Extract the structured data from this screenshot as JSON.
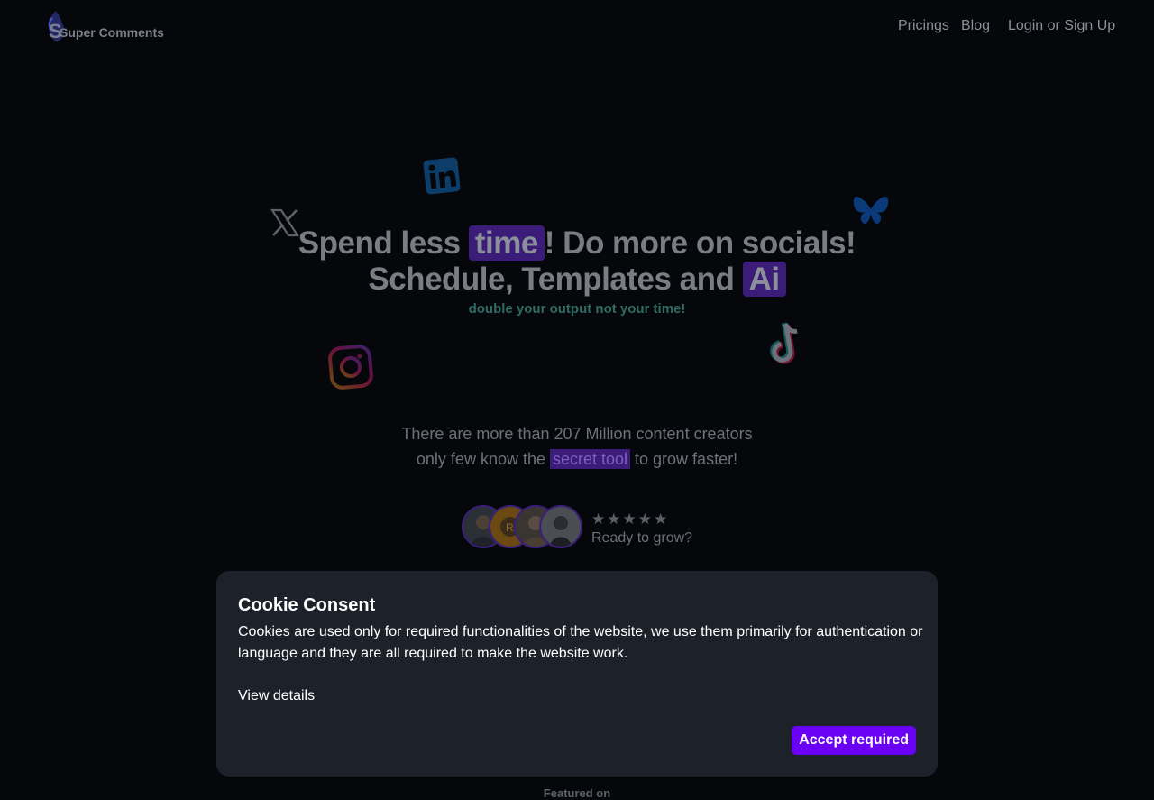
{
  "header": {
    "brand": "Super Comments",
    "nav": {
      "pricing": "Pricings",
      "blog": "Blog",
      "login": "Login or Sign Up"
    }
  },
  "hero": {
    "line1_before": "Spend less ",
    "line1_highlight": "time",
    "line1_after": "! Do more on socials!",
    "line2_before": "Schedule, Templates and ",
    "line2_highlight": "Ai",
    "tagline": "double your output not your time!",
    "social_icons": [
      "linkedin-icon",
      "x-icon",
      "bluesky-icon",
      "instagram-icon",
      "tiktok-icon"
    ]
  },
  "subheadline": {
    "line1": "There are more than 207 Million content creators",
    "line2_before": "only few know the ",
    "line2_highlight": "secret tool",
    "line2_after": " to grow faster!"
  },
  "social_proof": {
    "stars": "★★★★★",
    "rating": 5,
    "label": "Ready to grow?"
  },
  "featured": "Featured on",
  "cookie": {
    "title": "Cookie Consent",
    "text": "Cookies are used only for required functionalities of the website, we use them primarily for authentication or language and they are all required to make the website work.",
    "details_link": "View details",
    "accept_button": "Accept required"
  },
  "colors": {
    "accent": "#6a00f4",
    "highlight_bg": "#3b1c78",
    "tagline": "#2f6a63",
    "cookie_bg": "#1c212a"
  }
}
